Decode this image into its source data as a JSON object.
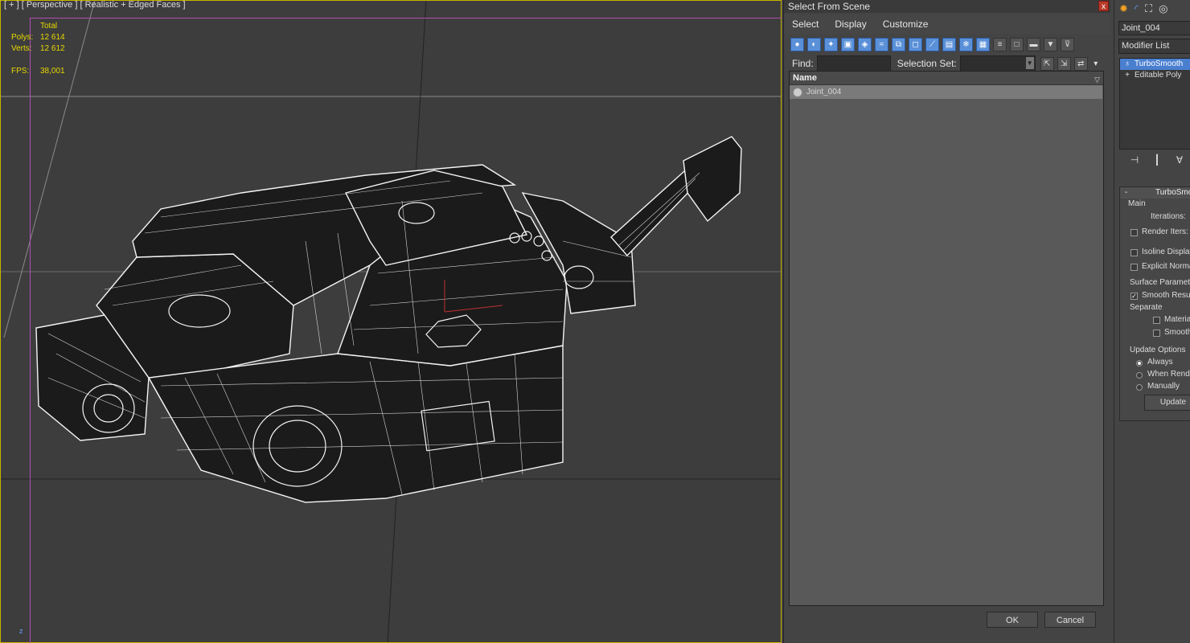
{
  "viewport": {
    "label": "[ + ] [ Perspective ] [ Realistic + Edged Faces ]",
    "stats": {
      "header": "Total",
      "polys_label": "Polys:",
      "polys_value": "12 614",
      "verts_label": "Verts:",
      "verts_value": "12 612",
      "fps_label": "FPS:",
      "fps_value": "38,001"
    },
    "axis_label": "z"
  },
  "dialog": {
    "title": "Select From Scene",
    "close_glyph": "x",
    "menu": [
      "Select",
      "Display",
      "Customize"
    ],
    "find_label": "Find:",
    "find_value": "",
    "selection_set_label": "Selection Set:",
    "selection_set_value": "",
    "list_header": "Name",
    "rows": [
      {
        "name": "Joint_004"
      }
    ],
    "ok_label": "OK",
    "cancel_label": "Cancel"
  },
  "command_panel": {
    "object_name": "Joint_004",
    "modifier_list_label": "Modifier List",
    "stack": [
      {
        "label": "TurboSmooth",
        "selected": true
      },
      {
        "label": "Editable Poly",
        "selected": false
      }
    ],
    "rollout_title": "TurboSmooth",
    "main_label": "Main",
    "iterations_label": "Iterations:",
    "render_iters_label": "Render Iters:",
    "isoline_label": "Isoline Display",
    "explicit_normals_label": "Explicit Normals",
    "surface_params_label": "Surface Parameters",
    "smooth_result_label": "Smooth Result",
    "separate_label": "Separate",
    "materials_label": "Materials",
    "smoothing_label": "Smoothing Groups",
    "update_options_label": "Update Options",
    "always_label": "Always",
    "when_rendering_label": "When Rendering",
    "manually_label": "Manually",
    "update_button": "Update"
  }
}
